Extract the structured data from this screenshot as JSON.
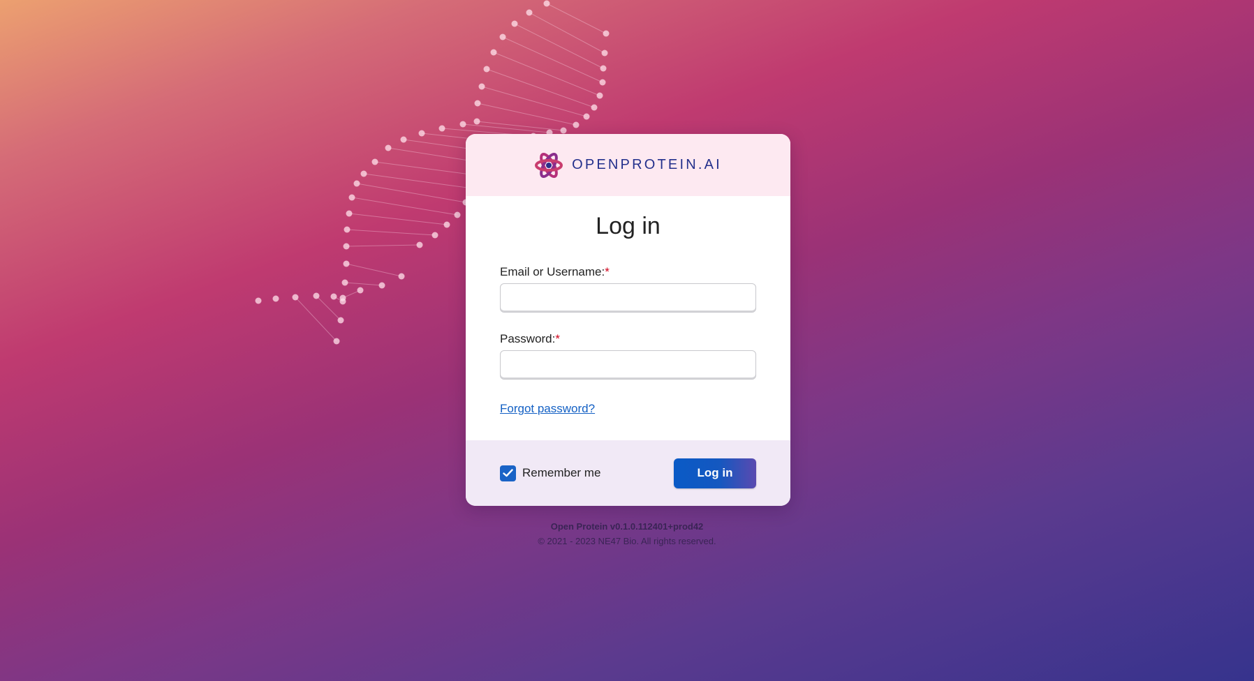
{
  "brand": {
    "name": "OPENPROTEIN.AI",
    "logo_icon": "protein-molecule-logo-icon"
  },
  "form": {
    "title": "Log in",
    "email_label": "Email or Username:",
    "password_label": "Password:",
    "required_marker": "*",
    "email_value": "",
    "password_value": "",
    "forgot_link": "Forgot password?",
    "remember_label": "Remember me",
    "remember_checked": true,
    "submit_label": "Log in"
  },
  "footer": {
    "version": "Open Protein v0.1.0.112401+prod42",
    "copyright": "© 2021 - 2023 NE47 Bio. All rights reserved."
  },
  "colors": {
    "accent": "#1a63c6",
    "brand_text": "#23308c",
    "required": "#d0021b",
    "header_bg": "#fde9f1",
    "footer_bg": "#f1e9f6"
  }
}
